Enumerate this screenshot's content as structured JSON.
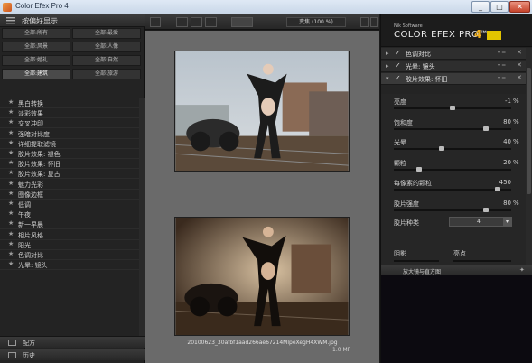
{
  "window": {
    "title": "Color Efex Pro 4",
    "minimize": "_",
    "maximize": "□",
    "close": "✕"
  },
  "left": {
    "header": "按偏好显示",
    "categories": [
      {
        "label": "全部:所有",
        "selected": false
      },
      {
        "label": "全部:最爱",
        "selected": false
      },
      {
        "label": "全部:风景",
        "selected": false
      },
      {
        "label": "全部:人像",
        "selected": false
      },
      {
        "label": "全部:婚礼",
        "selected": false
      },
      {
        "label": "全部:自然",
        "selected": false
      },
      {
        "label": "全部:建筑",
        "selected": true
      },
      {
        "label": "全部:旅游",
        "selected": false
      }
    ],
    "filters": [
      "黑白转换",
      "淡彩效果",
      "交叉冲印",
      "强暗对比度",
      "详细提取滤镜",
      "胶片效果: 褪色",
      "胶片效果: 怀旧",
      "胶片效果: 复古",
      "魅力光彩",
      "图像边框",
      "低调",
      "午夜",
      "新一早晨",
      "相片风格",
      "阳光",
      "色调对比",
      "光晕: 镜头"
    ],
    "bottom_tabs": [
      "配方",
      "历史"
    ]
  },
  "toolbar": {
    "zoom": "变焦 (100 %)"
  },
  "center": {
    "filename": "20100623_30afbf1aad266ae67214MlpeXegH4XWM.jpg",
    "filesize": "1.0 MP"
  },
  "right": {
    "brand_small": "Nik Software",
    "brand_big": "COLOR EFEX PRO™",
    "brand_version": "4",
    "stack": [
      {
        "name": "色调对比",
        "active": false
      },
      {
        "name": "光晕: 镜头",
        "active": false
      },
      {
        "name": "胶片效果: 怀旧",
        "active": true
      }
    ],
    "stack_controls": "▾ ═",
    "params": [
      {
        "label": "亮度",
        "value": "-1",
        "unit": "%",
        "level": 0.5
      },
      {
        "label": "饱和度",
        "value": "80",
        "unit": "%",
        "level": 0.8
      },
      {
        "label": "光晕",
        "value": "40",
        "unit": "%",
        "level": 0.4
      },
      {
        "label": "颗粒",
        "value": "20",
        "unit": "%",
        "level": 0.2
      },
      {
        "label": "每像素的颗粒",
        "value": "450",
        "unit": "",
        "level": 0.9
      },
      {
        "label": "胶片强度",
        "value": "80",
        "unit": "%",
        "level": 0.8
      }
    ],
    "film_type_label": "胶片种类",
    "film_type_value": "4",
    "shadow_label": "阴影",
    "highlight_label": "亮点",
    "loupe_header": "放大镜与直方图"
  },
  "colors": {
    "accent": "#f0b020",
    "center_bg": "#6a6a6a",
    "panel_bg": "#242424"
  }
}
